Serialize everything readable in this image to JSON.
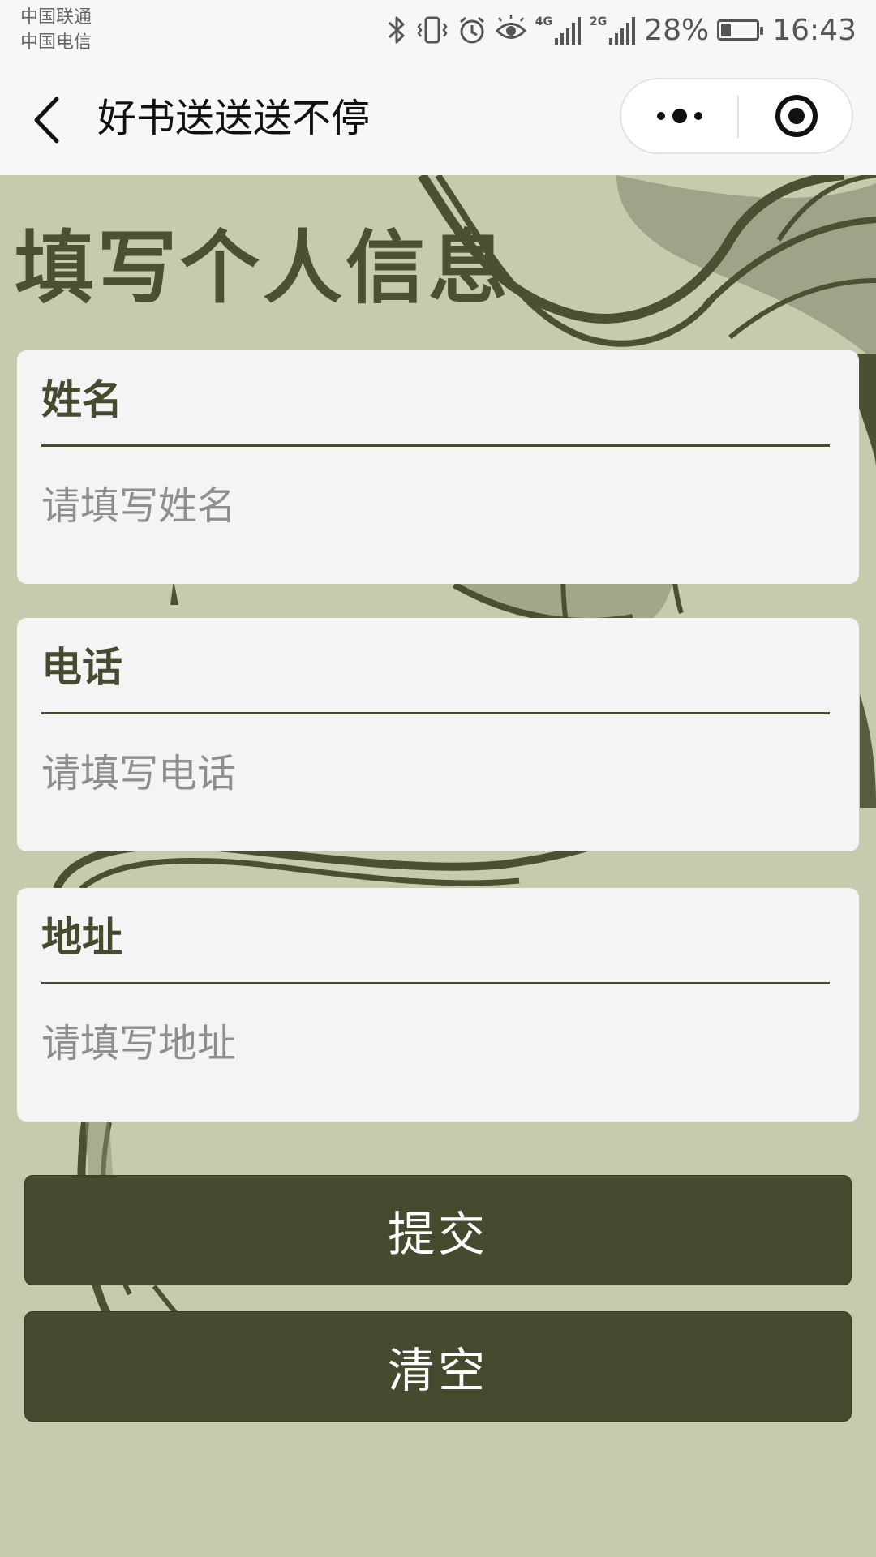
{
  "status_bar": {
    "carrier_1": "中国联通",
    "carrier_2": "中国电信",
    "network_1": "4G",
    "network_2": "2G",
    "battery_percent": "28%",
    "battery_level": 0.28,
    "time": "16:43",
    "icons": [
      "bluetooth-icon",
      "vibrate-icon",
      "alarm-icon",
      "eye-icon",
      "signal-icon",
      "signal-icon",
      "battery-icon"
    ]
  },
  "nav": {
    "title": "好书送送送不停",
    "icons": [
      "back-arrow-icon",
      "more-dots-icon",
      "target-close-icon"
    ]
  },
  "page": {
    "title": "填写个人信息"
  },
  "form": {
    "fields": [
      {
        "label": "姓名",
        "placeholder": "请填写姓名",
        "value": ""
      },
      {
        "label": "电话",
        "placeholder": "请填写电话",
        "value": ""
      },
      {
        "label": "地址",
        "placeholder": "请填写地址",
        "value": ""
      }
    ],
    "submit_label": "提交",
    "clear_label": "清空"
  },
  "colors": {
    "background": "#c4ccad",
    "primary": "#464b2f",
    "title": "#4a5132",
    "card": "#f4f4f4"
  }
}
